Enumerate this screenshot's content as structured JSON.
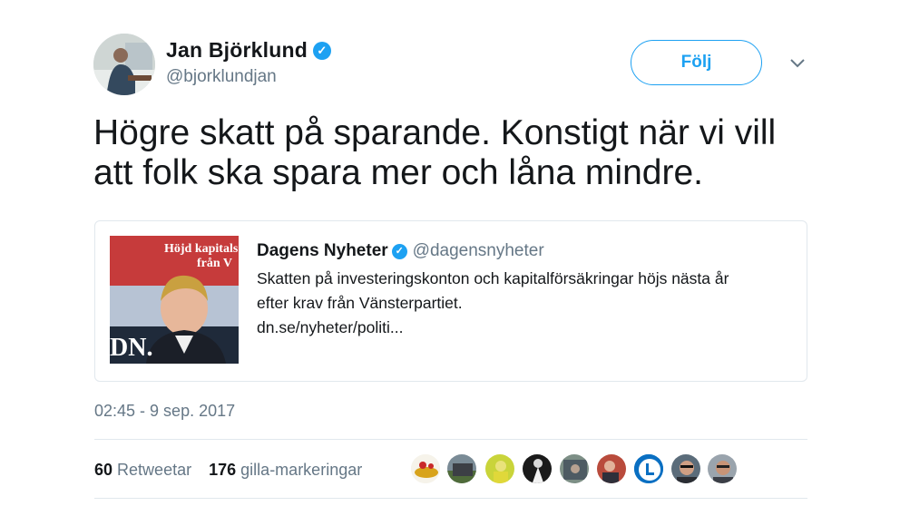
{
  "author": {
    "name": "Jan Björklund",
    "handle": "@bjorklundjan",
    "verified_icon": "verified-badge-icon"
  },
  "header": {
    "follow_label": "Följ",
    "more_icon": "chevron-down-icon"
  },
  "tweet": {
    "text_line1": "Högre skatt på sparande. Konstigt när vi vill",
    "text_line2": "att folk ska spara mer och låna mindre."
  },
  "quoted": {
    "image_caption_1": "Höjd kapitals",
    "image_caption_2": "från V",
    "image_logo": "DN.",
    "name": "Dagens Nyheter",
    "handle": "@dagensnyheter",
    "text_line1": "Skatten på investeringskonton och kapitalförsäkringar höjs nästa år",
    "text_line2": "efter krav från Vänsterpartiet.",
    "link": "dn.se/nyheter/politi..."
  },
  "timestamp": "02:45 - 9 sep. 2017",
  "stats": {
    "retweets_count": "60",
    "retweets_label": "Retweetar",
    "likes_count": "176",
    "likes_label": "gilla-markeringar"
  },
  "likers": [
    "avatar-1",
    "avatar-2",
    "avatar-3",
    "avatar-4",
    "avatar-5",
    "avatar-6",
    "avatar-7",
    "avatar-8",
    "avatar-9"
  ],
  "colors": {
    "accent": "#1da1f2",
    "muted": "#657786",
    "text": "#14171a",
    "border": "#e1e8ed"
  }
}
